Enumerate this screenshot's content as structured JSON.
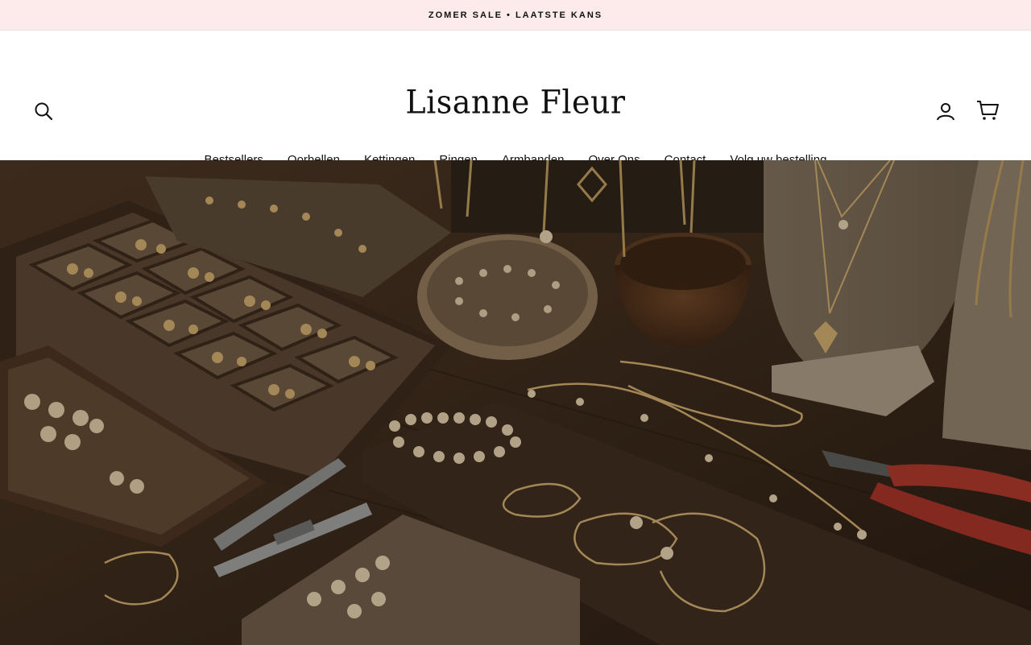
{
  "announcement": {
    "text": "ZOMER SALE • LAATSTE KANS"
  },
  "brand": {
    "logo_text": "Lisanne Fleur"
  },
  "header": {
    "search_icon": "search-icon",
    "account_icon": "user-icon",
    "cart_icon": "cart-icon"
  },
  "nav": {
    "items": [
      {
        "label": "Bestsellers"
      },
      {
        "label": "Oorbellen"
      },
      {
        "label": "Kettingen"
      },
      {
        "label": "Ringen"
      },
      {
        "label": "Armbanden"
      },
      {
        "label": "Over Ons"
      },
      {
        "label": "Contact"
      },
      {
        "label": "Volg uw bestelling"
      }
    ]
  },
  "hero": {
    "image": "jewelry-workshop-photo",
    "colors": {
      "table": "#3a2819",
      "gold": "#b8955a",
      "tray": "#4a3322",
      "bust": "#8c7c66"
    }
  }
}
